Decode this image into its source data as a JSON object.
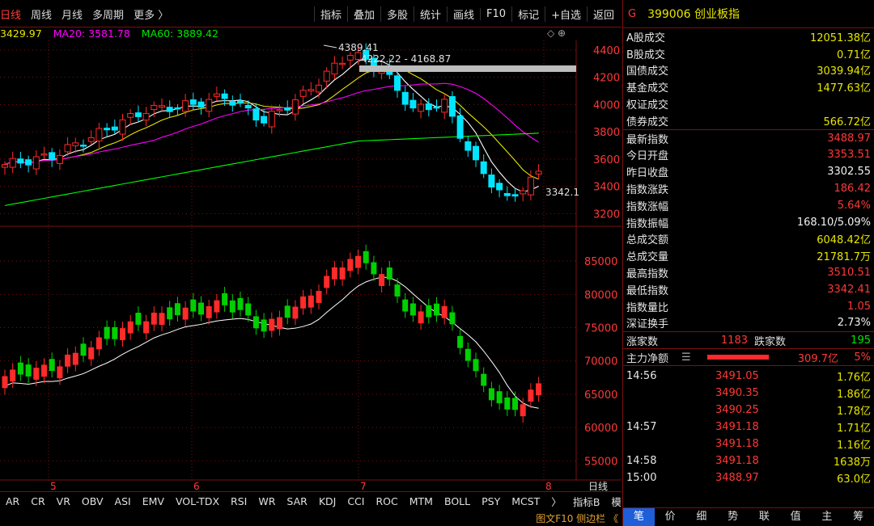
{
  "toolbar": {
    "left": [
      "日线",
      "周线",
      "月线",
      "多周期",
      "更多 〉"
    ],
    "right": [
      "指标",
      "叠加",
      "多股",
      "统计",
      "画线",
      "F10",
      "标记",
      "+自选",
      "返回"
    ]
  },
  "ma": {
    "ma10": "3429.97",
    "ma20": "MA20: 3581.78",
    "ma60": "MA60: 3889.42"
  },
  "chart": {
    "main_y_ticks": [
      "4400",
      "4200",
      "4000",
      "3800",
      "3600",
      "3400",
      "3200"
    ],
    "sub_y_ticks": [
      "85000",
      "80000",
      "75000",
      "70000",
      "65000",
      "60000",
      "55000"
    ],
    "x_ticks": [
      "5",
      "6",
      "7",
      "8"
    ],
    "x_unit": "日线",
    "high_label": "4389.41",
    "range_label": "4222.22 - 4168.87",
    "last_label": "3342.1"
  },
  "chart_data": {
    "type": "candlestick",
    "panels": [
      {
        "name": "price",
        "ylim": [
          3120,
          4470
        ],
        "y_ticks": [
          4400,
          4200,
          4000,
          3800,
          3600,
          3400,
          3200
        ]
      },
      {
        "name": "volume",
        "ylim": [
          52000,
          90000
        ],
        "y_ticks": [
          85000,
          80000,
          75000,
          70000,
          65000,
          60000,
          55000
        ]
      }
    ],
    "x_categories": [
      "5",
      "6",
      "7",
      "8"
    ]
  },
  "tabs": [
    "AR",
    "CR",
    "VR",
    "OBV",
    "ASI",
    "EMV",
    "VOL-TDX",
    "RSI",
    "WR",
    "SAR",
    "KDJ",
    "CCI",
    "ROC",
    "MTM",
    "BOLL",
    "PSY",
    "MCST",
    "〉",
    "指标B",
    "模 板"
  ],
  "f10bar": "图文F10  侧边栏 《",
  "panel": {
    "g": "G",
    "code": "399006 创业板指",
    "rows": [
      {
        "label": "A股成交",
        "value": "12051.38亿",
        "color": "yel"
      },
      {
        "label": "B股成交",
        "value": "0.71亿",
        "color": "yel"
      },
      {
        "label": "国债成交",
        "value": "3039.94亿",
        "color": "yel"
      },
      {
        "label": "基金成交",
        "value": "1477.63亿",
        "color": "yel"
      },
      {
        "label": "权证成交",
        "value": "",
        "color": "yel"
      },
      {
        "label": "债券成交",
        "value": "566.72亿",
        "color": "yel"
      }
    ],
    "rows2": [
      {
        "label": "最新指数",
        "value": "3488.97",
        "color": "red"
      },
      {
        "label": "今日开盘",
        "value": "3353.51",
        "color": "red"
      },
      {
        "label": "昨日收盘",
        "value": "3302.55",
        "color": "white"
      },
      {
        "label": "指数涨跌",
        "value": "186.42",
        "color": "red"
      },
      {
        "label": "指数涨幅",
        "value": "5.64%",
        "color": "red"
      },
      {
        "label": "指数振幅",
        "value": "168.10/5.09%",
        "color": "white"
      },
      {
        "label": "总成交额",
        "value": "6048.42亿",
        "color": "yel"
      },
      {
        "label": "总成交量",
        "value": "21781.7万",
        "color": "yel"
      },
      {
        "label": "最高指数",
        "value": "3510.51",
        "color": "red"
      },
      {
        "label": "最低指数",
        "value": "3342.41",
        "color": "red"
      },
      {
        "label": "指数量比",
        "value": "1.05",
        "color": "red"
      },
      {
        "label": "深证换手",
        "value": "2.73%",
        "color": "white"
      }
    ],
    "updown": {
      "up_label": "涨家数",
      "up": "1183",
      "down_label": "跌家数",
      "down": "195"
    },
    "flow": {
      "label": "主力净额",
      "value": "309.7亿",
      "pct": "5%"
    },
    "ticks": [
      {
        "t": "14:56",
        "p": "3491.05",
        "v": "1.76亿"
      },
      {
        "t": "",
        "p": "3490.35",
        "v": "1.86亿"
      },
      {
        "t": "",
        "p": "3490.25",
        "v": "1.78亿"
      },
      {
        "t": "14:57",
        "p": "3491.18",
        "v": "1.71亿"
      },
      {
        "t": "",
        "p": "3491.18",
        "v": "1.16亿"
      },
      {
        "t": "14:58",
        "p": "3491.18",
        "v": "1638万"
      },
      {
        "t": "15:00",
        "p": "3488.97",
        "v": "63.0亿"
      }
    ],
    "tabs": [
      "笔",
      "价",
      "细",
      "势",
      "联",
      "值",
      "主",
      "筹"
    ]
  },
  "colors": {
    "up": "#ff2a2a",
    "down": "#00e5ff",
    "vol_down": "#00d000",
    "ma5": "#ffffff",
    "ma10": "#e6e600",
    "ma20": "#ff00ff",
    "ma60": "#00ff00",
    "border": "#7a1010"
  }
}
